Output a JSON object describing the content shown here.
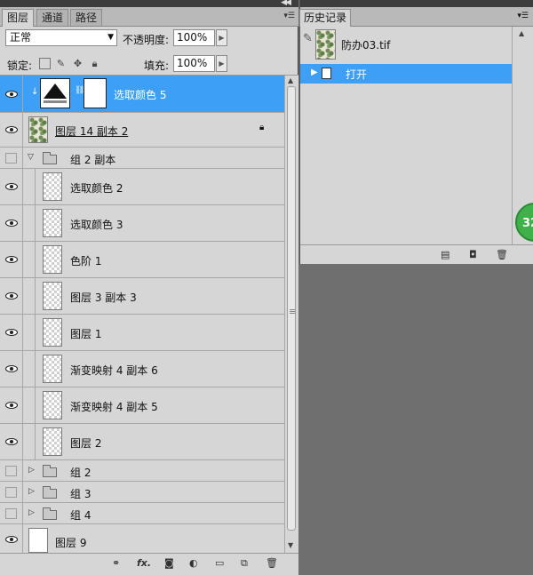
{
  "layers_panel": {
    "tabs": [
      {
        "label": "图层",
        "active": true
      },
      {
        "label": "通道",
        "active": false
      },
      {
        "label": "路径",
        "active": false
      }
    ],
    "blend_mode": "正常",
    "opacity_label": "不透明度:",
    "opacity_value": "100%",
    "lock_label": "锁定:",
    "fill_label": "填充:",
    "fill_value": "100%",
    "layers": [
      {
        "name": "选取颜色 5",
        "selected": true,
        "visible": true
      },
      {
        "name": "图层 14 副本 2",
        "visible": true,
        "locked": true
      },
      {
        "name": "组 2 副本",
        "type": "group",
        "expanded": true,
        "visible": false
      },
      {
        "name": "选取颜色 2",
        "visible": true
      },
      {
        "name": "选取颜色 3",
        "visible": true
      },
      {
        "name": "色阶 1",
        "visible": true
      },
      {
        "name": "图层 3 副本 3",
        "visible": true
      },
      {
        "name": "图层 1",
        "visible": true
      },
      {
        "name": "渐变映射 4 副本 6",
        "visible": true
      },
      {
        "name": "渐变映射 4 副本 5",
        "visible": true
      },
      {
        "name": "图层 2",
        "visible": true
      },
      {
        "name": "组 2",
        "type": "group",
        "expanded": false,
        "visible": false
      },
      {
        "name": "组 3",
        "type": "group",
        "expanded": false,
        "visible": false
      },
      {
        "name": "组 4",
        "type": "group",
        "expanded": false,
        "visible": false
      },
      {
        "name": "图层 9",
        "visible": true
      }
    ],
    "footer_icons": [
      "link-icon",
      "fx-icon",
      "mask-icon",
      "adjustment-icon",
      "group-icon",
      "new-layer-icon",
      "trash-icon"
    ],
    "fx_label": "fx."
  },
  "history_panel": {
    "tab_label": "历史记录",
    "document_name": "防办03.tif",
    "step_label": "打开"
  },
  "badge_text": "32"
}
